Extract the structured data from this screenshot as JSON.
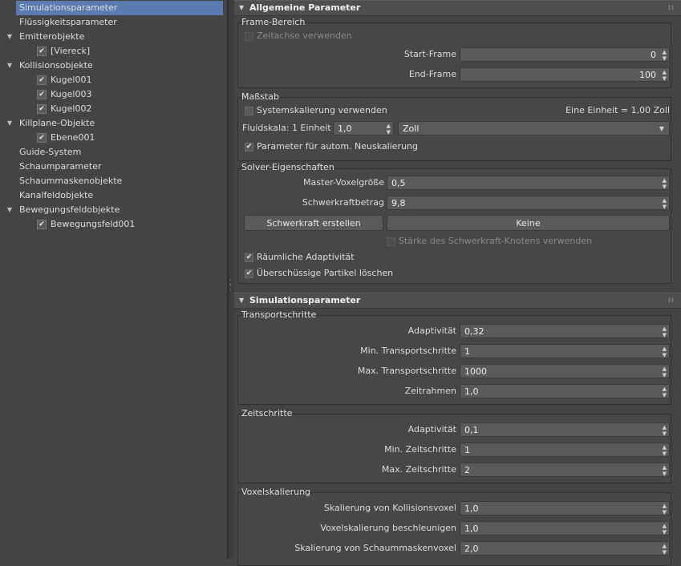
{
  "tree": {
    "items": [
      {
        "label": "Simulationsparameter",
        "level": 0,
        "expandable": false,
        "checked": false,
        "selected": true
      },
      {
        "label": "Flüssigkeitsparameter",
        "level": 0,
        "expandable": false,
        "checked": false,
        "selected": false
      },
      {
        "label": "Emitterobjekte",
        "level": 0,
        "expandable": true,
        "checked": false,
        "selected": false
      },
      {
        "label": "[Viereck]",
        "level": 1,
        "expandable": false,
        "checked": true,
        "selected": false
      },
      {
        "label": "Kollisionsobjekte",
        "level": 0,
        "expandable": true,
        "checked": false,
        "selected": false
      },
      {
        "label": "Kugel001",
        "level": 1,
        "expandable": false,
        "checked": true,
        "selected": false
      },
      {
        "label": "Kugel003",
        "level": 1,
        "expandable": false,
        "checked": true,
        "selected": false
      },
      {
        "label": "Kugel002",
        "level": 1,
        "expandable": false,
        "checked": true,
        "selected": false
      },
      {
        "label": "Killplane-Objekte",
        "level": 0,
        "expandable": true,
        "checked": false,
        "selected": false
      },
      {
        "label": "Ebene001",
        "level": 1,
        "expandable": false,
        "checked": true,
        "selected": false
      },
      {
        "label": "Guide-System",
        "level": 0,
        "expandable": false,
        "checked": false,
        "selected": false
      },
      {
        "label": "Schaumparameter",
        "level": 0,
        "expandable": false,
        "checked": false,
        "selected": false
      },
      {
        "label": "Schaummaskenobjekte",
        "level": 0,
        "expandable": false,
        "checked": false,
        "selected": false
      },
      {
        "label": "Kanalfeldobjekte",
        "level": 0,
        "expandable": false,
        "checked": false,
        "selected": false
      },
      {
        "label": "Bewegungsfeldobjekte",
        "level": 0,
        "expandable": true,
        "checked": false,
        "selected": false
      },
      {
        "label": "Bewegungsfeld001",
        "level": 1,
        "expandable": false,
        "checked": true,
        "selected": false
      }
    ]
  },
  "allgemein": {
    "title": "Allgemeine Parameter",
    "frame": {
      "title": "Frame-Bereich",
      "use_timeline": "Zeitachse verwenden",
      "start_label": "Start-Frame",
      "start_value": "0",
      "end_label": "End-Frame",
      "end_value": "100"
    },
    "scale": {
      "title": "Maßstab",
      "system_scale": "Systemskalierung verwenden",
      "unit_info": "Eine Einheit = 1,00 Zoll",
      "fluid_label": "Fluidskala: 1 Einheit =",
      "fluid_value": "1,0",
      "unit_option": "Zoll",
      "auto_rescale": "Parameter für autom. Neuskalierung"
    },
    "solver": {
      "title": "Solver-Eigenschaften",
      "voxel_label": "Master-Voxelgröße",
      "voxel_value": "0,5",
      "gravity_label": "Schwerkraftbetrag",
      "gravity_value": "9,8",
      "create_gravity": "Schwerkraft erstellen",
      "none_button": "Keine",
      "gravity_node": "Stärke des Schwerkraft-Knotens verwenden",
      "spatial": "Räumliche Adaptivität",
      "delete_excess": "Überschüssige Partikel löschen"
    }
  },
  "simparam": {
    "title": "Simulationsparameter",
    "transport": {
      "title": "Transportschritte",
      "rows": [
        {
          "label": "Adaptivität",
          "value": "0,32"
        },
        {
          "label": "Min. Transportschritte",
          "value": "1"
        },
        {
          "label": "Max. Transportschritte",
          "value": "1000"
        },
        {
          "label": "Zeitrahmen",
          "value": "1,0"
        }
      ]
    },
    "time": {
      "title": "Zeitschritte",
      "rows": [
        {
          "label": "Adaptivität",
          "value": "0,1"
        },
        {
          "label": "Min. Zeitschritte",
          "value": "1"
        },
        {
          "label": "Max. Zeitschritte",
          "value": "2"
        }
      ]
    },
    "voxel": {
      "title": "Voxelskalierung",
      "rows": [
        {
          "label": "Skalierung von Kollisionsvoxel",
          "value": "1,0"
        },
        {
          "label": "Voxelskalierung beschleunigen",
          "value": "1,0"
        },
        {
          "label": "Skalierung von Schaummaskenvoxel",
          "value": "2,0"
        }
      ]
    }
  }
}
